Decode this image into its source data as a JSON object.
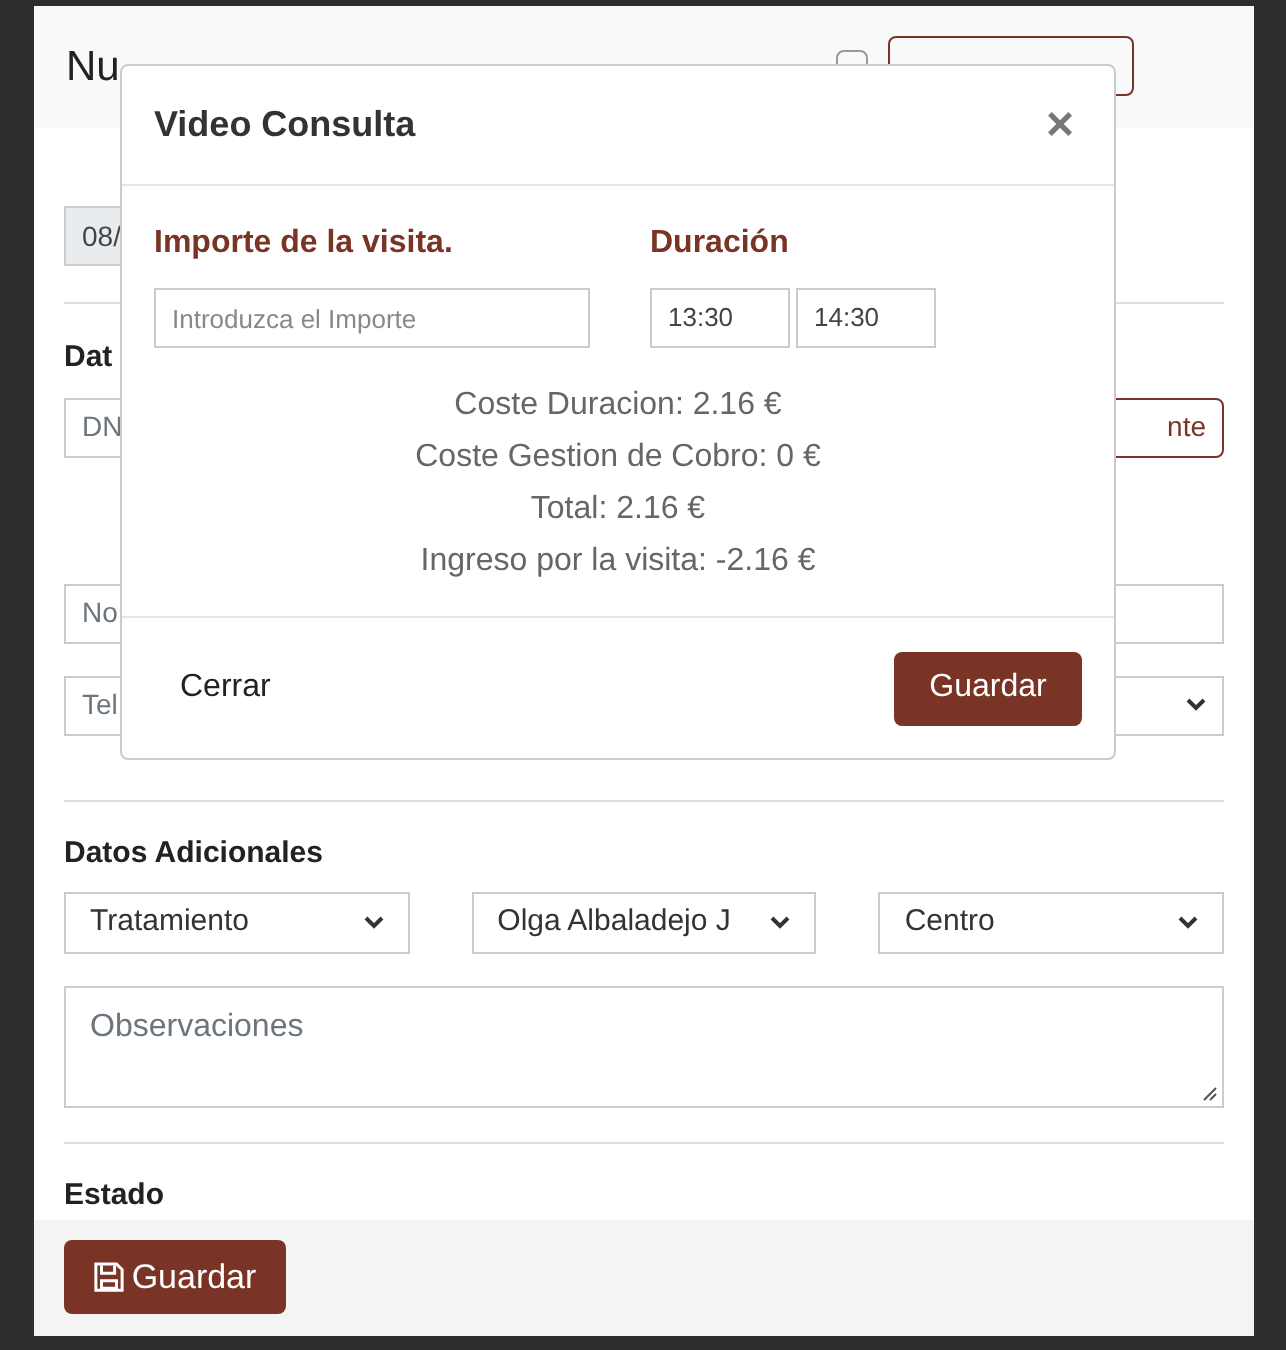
{
  "form": {
    "title": "Nu",
    "video_toggle": {
      "checked": false
    },
    "date_field": {
      "value": "08/"
    },
    "section_1": "Dat",
    "dni_field": {
      "placeholder": "DN"
    },
    "side_button": "nte",
    "name_field": {
      "placeholder": "No"
    },
    "phone_field": {
      "placeholder": "Tel"
    },
    "section_2": "Datos Adicionales",
    "selects": [
      {
        "value": "Tratamiento"
      },
      {
        "value": "Olga Albaladejo J"
      },
      {
        "value": "Centro"
      }
    ],
    "notes": {
      "placeholder": "Observaciones"
    },
    "section_3": "Estado",
    "save_button": "Guardar"
  },
  "dialog": {
    "title": "Video Consulta",
    "close": "×",
    "amount_label": "Importe de la visita.",
    "amount_field": {
      "placeholder": "Introduzca el Importe"
    },
    "duration_label": "Duración",
    "start_time": "13:30",
    "end_time": "14:30",
    "summary": [
      "Coste Duracion: 2.16 €",
      "Coste Gestion de Cobro: 0 €",
      "Total: 2.16 €",
      "Ingreso por la visita: -2.16 €"
    ],
    "close_button": "Cerrar",
    "save_button": "Guardar"
  }
}
